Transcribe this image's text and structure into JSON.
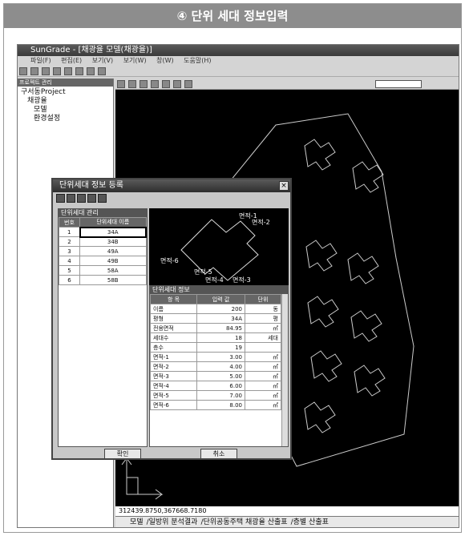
{
  "header": {
    "title": "④ 단위 세대 정보입력"
  },
  "app": {
    "title": "SunGrade - [채광율 모델(채광율)]",
    "menu": [
      "파일(F)",
      "편집(E)",
      "보기(V)",
      "보기(W)",
      "창(W)",
      "도움말(H)"
    ],
    "side_title": "프로젝트 관리",
    "tree": [
      "구서동Project",
      "채광율",
      "모델",
      "환경설정"
    ],
    "status": "312439.8750,367668.7180",
    "tabs": [
      "모델",
      "일방위 분석결과",
      "단위공동주택 채광율 산출표",
      "층별 산출표"
    ]
  },
  "dialog": {
    "title": "단위세대 정보 등록",
    "left_caption": "단위세대 관리",
    "left_headers": [
      "번호",
      "단위세대 이름"
    ],
    "units": [
      {
        "no": "1",
        "name": "34A"
      },
      {
        "no": "2",
        "name": "34B"
      },
      {
        "no": "3",
        "name": "49A"
      },
      {
        "no": "4",
        "name": "49B"
      },
      {
        "no": "5",
        "name": "58A"
      },
      {
        "no": "6",
        "name": "58B"
      }
    ],
    "preview_labels": [
      "면적-1",
      "면적-2",
      "면적-3",
      "면적-4",
      "면적-5",
      "면적-6"
    ],
    "right_caption": "단위세대 정보",
    "right_headers": [
      "항 목",
      "입력 값",
      "단위"
    ],
    "props": [
      {
        "item": "이름",
        "value": "200",
        "unit": "동"
      },
      {
        "item": "평형",
        "value": "34A",
        "unit": "평"
      },
      {
        "item": "전용면적",
        "value": "84.95",
        "unit": "㎡"
      },
      {
        "item": "세대수",
        "value": "18",
        "unit": "세대"
      },
      {
        "item": "층수",
        "value": "19",
        "unit": ""
      },
      {
        "item": "면적-1",
        "value": "3.00",
        "unit": "㎡"
      },
      {
        "item": "면적-2",
        "value": "4.00",
        "unit": "㎡"
      },
      {
        "item": "면적-3",
        "value": "5.00",
        "unit": "㎡"
      },
      {
        "item": "면적-4",
        "value": "6.00",
        "unit": "㎡"
      },
      {
        "item": "면적-5",
        "value": "7.00",
        "unit": "㎡"
      },
      {
        "item": "면적-6",
        "value": "8.00",
        "unit": "㎡"
      }
    ],
    "ok_label": "확인",
    "cancel_label": "취소"
  }
}
